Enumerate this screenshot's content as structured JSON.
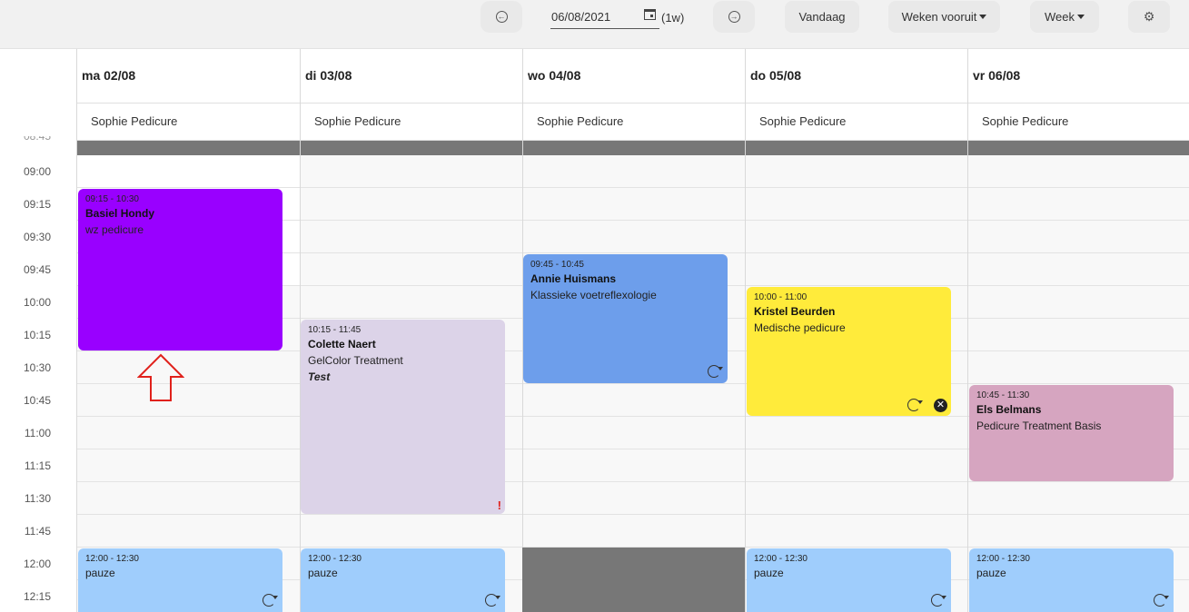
{
  "toolbar": {
    "prev_icon": "arrow-left-circle-icon",
    "date_value": "06/08/2021",
    "calendar_icon": "calendar-icon",
    "week_label": "(1w)",
    "next_icon": "arrow-right-circle-icon",
    "today_label": "Vandaag",
    "weeks_ahead_label": "Weken vooruit",
    "view_label": "Week",
    "settings_icon": "gear-icon"
  },
  "time_labels": [
    "09:00",
    "09:15",
    "09:30",
    "09:45",
    "10:00",
    "10:15",
    "10:30",
    "10:45",
    "11:00",
    "11:15",
    "11:30",
    "11:45",
    "12:00",
    "12:15"
  ],
  "partial_time_label": "08:45",
  "days": [
    {
      "label": "ma 02/08",
      "resource": "Sophie Pedicure"
    },
    {
      "label": "di 03/08",
      "resource": "Sophie Pedicure"
    },
    {
      "label": "wo 04/08",
      "resource": "Sophie Pedicure"
    },
    {
      "label": "do 05/08",
      "resource": "Sophie Pedicure"
    },
    {
      "label": "vr 06/08",
      "resource": "Sophie Pedicure"
    }
  ],
  "events": {
    "e1": {
      "time": "09:15 - 10:30",
      "name": "Basiel Hondy",
      "service": "wz pedicure",
      "color": "#9900ff"
    },
    "e2": {
      "time": "10:15 - 11:45",
      "name": "Colette Naert",
      "service": "GelColor Treatment",
      "note": "Test",
      "color": "#dcd3e8",
      "warning": "!"
    },
    "e3": {
      "time": "09:45 - 10:45",
      "name": "Annie Huismans",
      "service": "Klassieke voetreflexologie",
      "color": "#6d9eeb"
    },
    "e4": {
      "time": "10:00 - 11:00",
      "name": "Kristel Beurden",
      "service": "Medische pedicure",
      "color": "#ffeb3b"
    },
    "e5": {
      "time": "10:45 - 11:30",
      "name": "Els Belmans",
      "service": "Pedicure Treatment Basis",
      "color": "#d6a5c0"
    },
    "p1": {
      "time": "12:00 - 12:30",
      "label": "pauze",
      "color": "#9fcdfc"
    },
    "p2": {
      "time": "12:00 - 12:30",
      "label": "pauze",
      "color": "#9fcdfc"
    },
    "p4": {
      "time": "12:00 - 12:30",
      "label": "pauze",
      "color": "#9fcdfc"
    },
    "p5": {
      "time": "12:00 - 12:30",
      "label": "pauze",
      "color": "#9fcdfc"
    }
  },
  "colors": {
    "closed": "#777777",
    "annotation_arrow": "#e0211b"
  }
}
